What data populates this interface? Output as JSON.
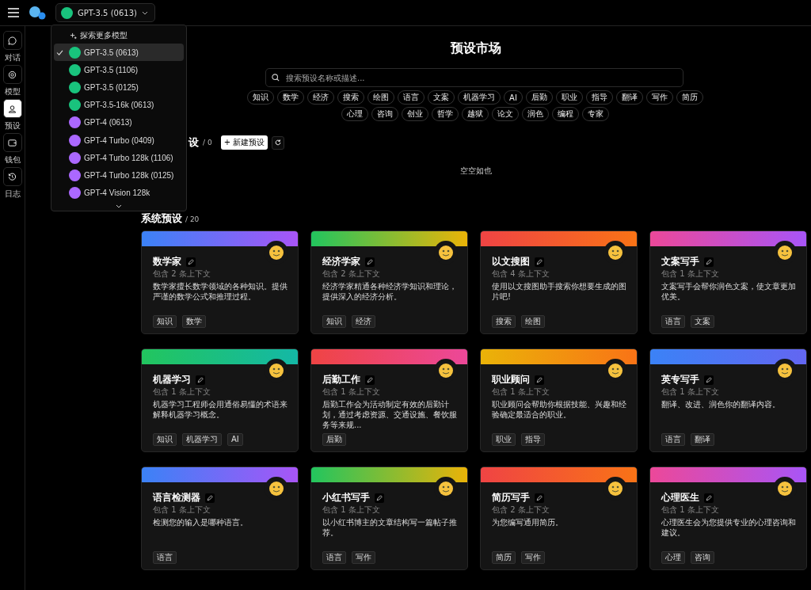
{
  "topbar": {
    "model": "GPT-3.5 (0613)"
  },
  "sidebar": [
    {
      "label": "对话",
      "kind": "chat",
      "selected": false
    },
    {
      "label": "模型",
      "kind": "model",
      "selected": false
    },
    {
      "label": "预设",
      "kind": "preset",
      "selected": true
    },
    {
      "label": "钱包",
      "kind": "wallet",
      "selected": false
    },
    {
      "label": "日志",
      "kind": "history",
      "selected": false
    }
  ],
  "dropdown": {
    "explore": "探索更多模型",
    "items": [
      {
        "label": "GPT-3.5 (0613)",
        "color": "#19c37d",
        "selected": true
      },
      {
        "label": "GPT-3.5 (1106)",
        "color": "#19c37d",
        "selected": false
      },
      {
        "label": "GPT-3.5 (0125)",
        "color": "#19c37d",
        "selected": false
      },
      {
        "label": "GPT-3.5-16k (0613)",
        "color": "#19c37d",
        "selected": false
      },
      {
        "label": "GPT-4 (0613)",
        "color": "#ab68ff",
        "selected": false
      },
      {
        "label": "GPT-4 Turbo (0409)",
        "color": "#ab68ff",
        "selected": false
      },
      {
        "label": "GPT-4 Turbo 128k (1106)",
        "color": "#ab68ff",
        "selected": false
      },
      {
        "label": "GPT-4 Turbo 128k (0125)",
        "color": "#ab68ff",
        "selected": false
      },
      {
        "label": "GPT-4 Vision 128k",
        "color": "#ab68ff",
        "selected": false
      }
    ]
  },
  "market": {
    "title": "预设市场",
    "search": {
      "placeholder": "搜索预设名称或描述..."
    },
    "tags": [
      "知识",
      "数学",
      "经济",
      "搜索",
      "绘图",
      "语言",
      "文案",
      "机器学习",
      "AI",
      "后勤",
      "职业",
      "指导",
      "翻译",
      "写作",
      "简历",
      "心理",
      "咨询",
      "创业",
      "哲学",
      "越狱",
      "论文",
      "润色",
      "编程",
      "专家"
    ]
  },
  "user_presets": {
    "title": "设",
    "count": "/ 0",
    "new_button": "+ 新建预设",
    "empty": "空空如也"
  },
  "system_presets": {
    "title": "系统预设",
    "count": "/ 20",
    "cards": [
      {
        "name": "数学家",
        "context": "包含 2 条上下文",
        "desc": "数学家擅长数学领域的各种知识。提供严谨的数学公式和推理过程。",
        "tags": [
          "知识",
          "数学"
        ],
        "kind": "blue-purple"
      },
      {
        "name": "经济学家",
        "context": "包含 2 条上下文",
        "desc": "经济学家精通各种经济学知识和理论，提供深入的经济分析。",
        "tags": [
          "知识",
          "经济"
        ],
        "kind": "green-yellow"
      },
      {
        "name": "以文搜图",
        "context": "包含 4 条上下文",
        "desc": "使用以文搜图助手搜索你想要生成的图片吧!",
        "tags": [
          "搜索",
          "绘图"
        ],
        "kind": "red-orange"
      },
      {
        "name": "文案写手",
        "context": "包含 1 条上下文",
        "desc": "文案写手会帮你润色文案，使文章更加优美。",
        "tags": [
          "语言",
          "文案"
        ],
        "kind": "pink-purple"
      },
      {
        "name": "机器学习",
        "context": "包含 1 条上下文",
        "desc": "机器学习工程师会用通俗易懂的术语来解释机器学习概念。",
        "tags": [
          "知识",
          "机器学习",
          "AI"
        ],
        "kind": "green-teal"
      },
      {
        "name": "后勤工作",
        "context": "包含 1 条上下文",
        "desc": "后勤工作会为活动制定有效的后勤计划，通过考虑资源、交通设施、餐饮服务等来规...",
        "tags": [
          "后勤"
        ],
        "kind": "red-pink"
      },
      {
        "name": "职业顾问",
        "context": "包含 1 条上下文",
        "desc": "职业顾问会帮助你根据技能、兴趣和经验确定最适合的职业。",
        "tags": [
          "职业",
          "指导"
        ],
        "kind": "yellow-orange"
      },
      {
        "name": "英专写手",
        "context": "包含 1 条上下文",
        "desc": "翻译、改进、润色你的翻译内容。",
        "tags": [
          "语言",
          "翻译"
        ],
        "kind": "blue-indigo"
      },
      {
        "name": "语言检测器",
        "context": "包含 1 条上下文",
        "desc": "检测您的输入是哪种语言。",
        "tags": [
          "语言"
        ],
        "kind": "blue-purple"
      },
      {
        "name": "小红书写手",
        "context": "包含 1 条上下文",
        "desc": "以小红书博主的文章结构写一篇帖子推荐。",
        "tags": [
          "语言",
          "写作"
        ],
        "kind": "green-yellow"
      },
      {
        "name": "简历写手",
        "context": "包含 2 条上下文",
        "desc": "为您编写通用简历。",
        "tags": [
          "简历",
          "写作"
        ],
        "kind": "red-orange"
      },
      {
        "name": "心理医生",
        "context": "包含 1 条上下文",
        "desc": "心理医生会为您提供专业的心理咨询和建议。",
        "tags": [
          "心理",
          "咨询"
        ],
        "kind": "pink-purple"
      }
    ]
  }
}
